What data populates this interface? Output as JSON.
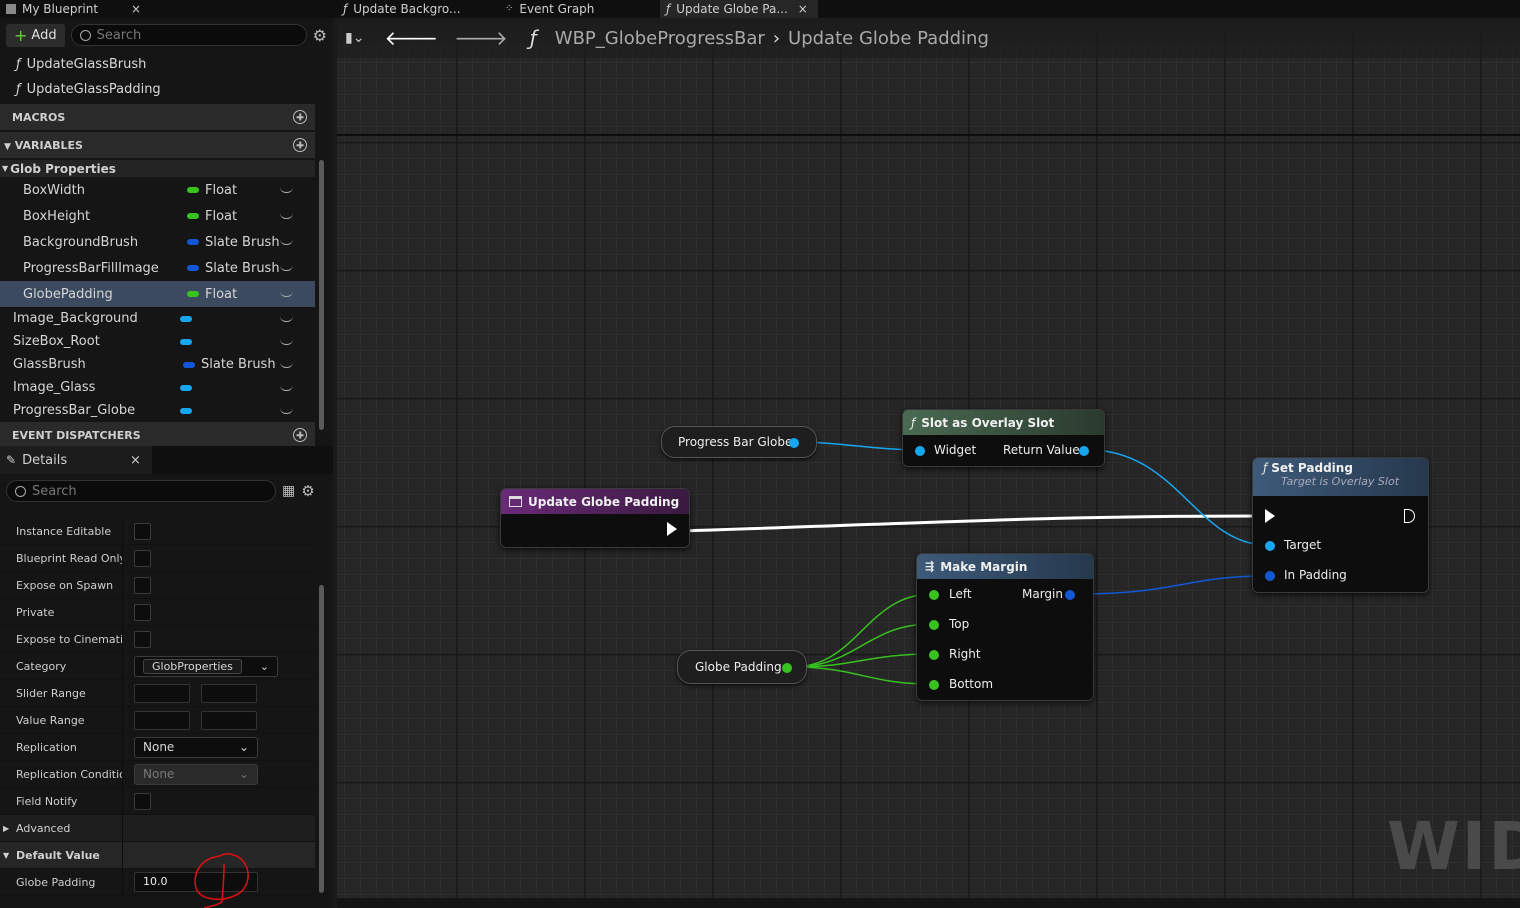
{
  "window": {
    "panel_title": "My Blueprint",
    "tabs": [
      "Update Backgro...",
      "Event Graph",
      "Update Globe Pa..."
    ]
  },
  "blueprint_panel": {
    "add_label": "Add",
    "search_placeholder": "Search",
    "functions": [
      "UpdateGlassBrush",
      "UpdateGlassPadding"
    ],
    "sections": {
      "macros": "MACROS",
      "variables": "VARIABLES",
      "event_dispatchers": "EVENT DISPATCHERS"
    },
    "category": "Glob Properties",
    "variables": [
      {
        "name": "BoxWidth",
        "type": "Float",
        "color": "#37c21f"
      },
      {
        "name": "BoxHeight",
        "type": "Float",
        "color": "#37c21f"
      },
      {
        "name": "BackgroundBrush",
        "type": "Slate Brush",
        "color": "#1357d6"
      },
      {
        "name": "ProgressBarFillImage",
        "type": "Slate Brush",
        "color": "#1357d6"
      },
      {
        "name": "GlobePadding",
        "type": "Float",
        "color": "#37c21f"
      },
      {
        "name": "Image_Background",
        "type": "",
        "color": "#17a6f0"
      },
      {
        "name": "SizeBox_Root",
        "type": "",
        "color": "#17a6f0"
      },
      {
        "name": "GlassBrush",
        "type": "Slate Brush",
        "color": "#1357d6"
      },
      {
        "name": "Image_Glass",
        "type": "",
        "color": "#17a6f0"
      },
      {
        "name": "ProgressBar_Globe",
        "type": "",
        "color": "#17a6f0"
      }
    ]
  },
  "details": {
    "title": "Details",
    "search_placeholder": "Search",
    "rows": {
      "instance_editable": "Instance Editable",
      "bp_read_only": "Blueprint Read Only",
      "expose_on_spawn": "Expose on Spawn",
      "private": "Private",
      "expose_cinematics": "Expose to Cinematics",
      "category": "Category",
      "category_value": "GlobProperties",
      "slider_range": "Slider Range",
      "value_range": "Value Range",
      "replication": "Replication",
      "replication_value": "None",
      "replication_condition": "Replication Condition",
      "replication_condition_value": "None",
      "field_notify": "Field Notify",
      "advanced": "Advanced",
      "default_value": "Default Value",
      "globe_padding": "Globe Padding",
      "globe_padding_value": "10.0"
    }
  },
  "graph": {
    "breadcrumb": {
      "blueprint": "WBP_GlobeProgressBar",
      "function": "Update Globe Padding"
    },
    "watermark": "WIDG",
    "nodes": {
      "entry": "Update Globe Padding",
      "progress_bar_globe": "Progress Bar Globe",
      "slot_as_overlay": {
        "title": "Slot as Overlay Slot",
        "in": "Widget",
        "out": "Return Value"
      },
      "set_padding": {
        "title": "Set Padding",
        "subtitle": "Target is Overlay Slot",
        "target": "Target",
        "in_padding": "In Padding"
      },
      "make_margin": {
        "title": "Make Margin",
        "left": "Left",
        "top": "Top",
        "right": "Right",
        "bottom": "Bottom",
        "out": "Margin"
      },
      "globe_padding": "Globe Padding"
    },
    "colors": {
      "float": "#37c21f",
      "object": "#17a6f0",
      "struct": "#1357d6",
      "function_header": "#4a6a52",
      "entry_header": "#6a2a78",
      "set_header": "#3d5a7a"
    }
  }
}
